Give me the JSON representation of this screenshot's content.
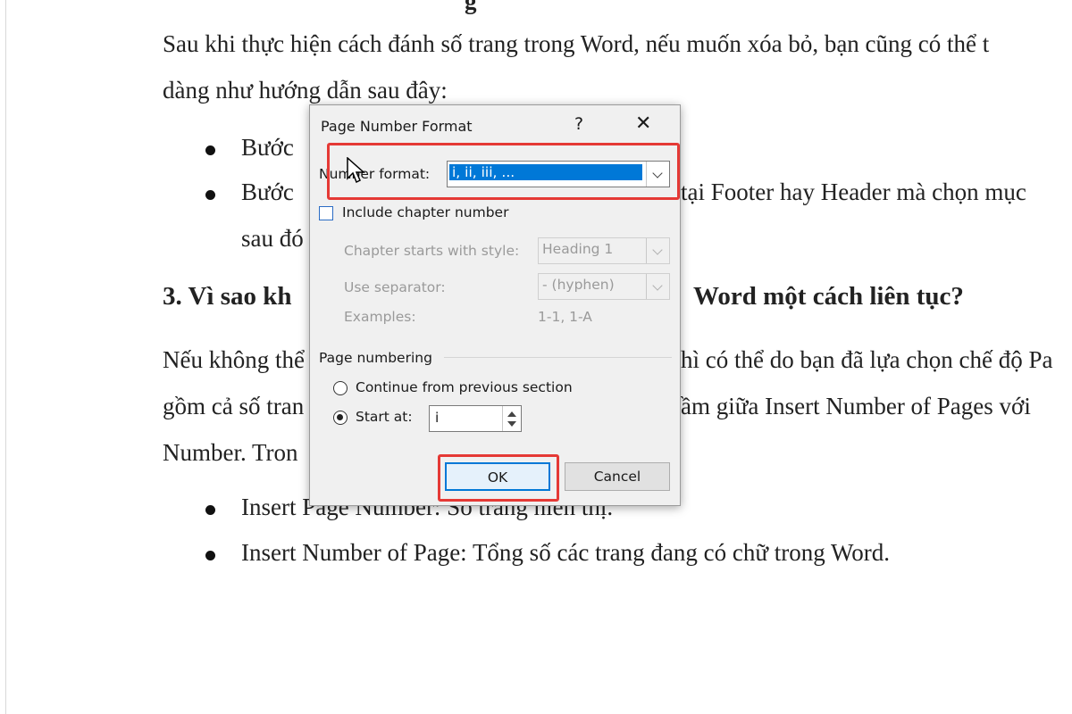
{
  "document": {
    "top_fragment": "g",
    "para1_line1": "Sau khi thực hiện cách đánh số trang trong Word, nếu muốn xóa bỏ, bạn cũng có thể t",
    "para1_line2": "dàng như hướng dẫn sau đây:",
    "bullet1": "Bước",
    "bullet2_left": "Bước",
    "bullet2_right": "tại Footer hay Header mà chọn mục",
    "bullet2_cont": "sau đó",
    "heading_left": "3. Vì sao kh",
    "heading_right": "Word một cách liên tục?",
    "para2_line1_left": "Nếu không thể",
    "para2_line1_right": "hì có thể do bạn đã lựa chọn chế độ Pa",
    "para2_line2_left": "gồm cả số tran",
    "para2_line2_right": "ầm giữa Insert Number of Pages với",
    "para2_line3": "Number. Tron",
    "bullet3": "Insert Page Number: Số trang hiển thị.",
    "bullet4": "Insert Number of Page: Tổng số các trang đang có chữ trong Word."
  },
  "dialog": {
    "title": "Page Number Format",
    "help": "?",
    "close": "✕",
    "number_format_label": "Number format:",
    "number_format_value": "i, ii, iii, ...",
    "include_chapter_label": "Include chapter number",
    "chapter_style_label": "Chapter starts with style:",
    "chapter_style_value": "Heading 1",
    "separator_label": "Use separator:",
    "separator_value": "-   (hyphen)",
    "examples_label": "Examples:",
    "examples_value": "1-1, 1-A",
    "page_numbering_label": "Page numbering",
    "continue_label": "Continue from previous section",
    "start_at_label": "Start at:",
    "start_at_value": "i",
    "ok_label": "OK",
    "cancel_label": "Cancel"
  },
  "colors": {
    "highlight": "#e53935",
    "selection": "#0078d7"
  }
}
